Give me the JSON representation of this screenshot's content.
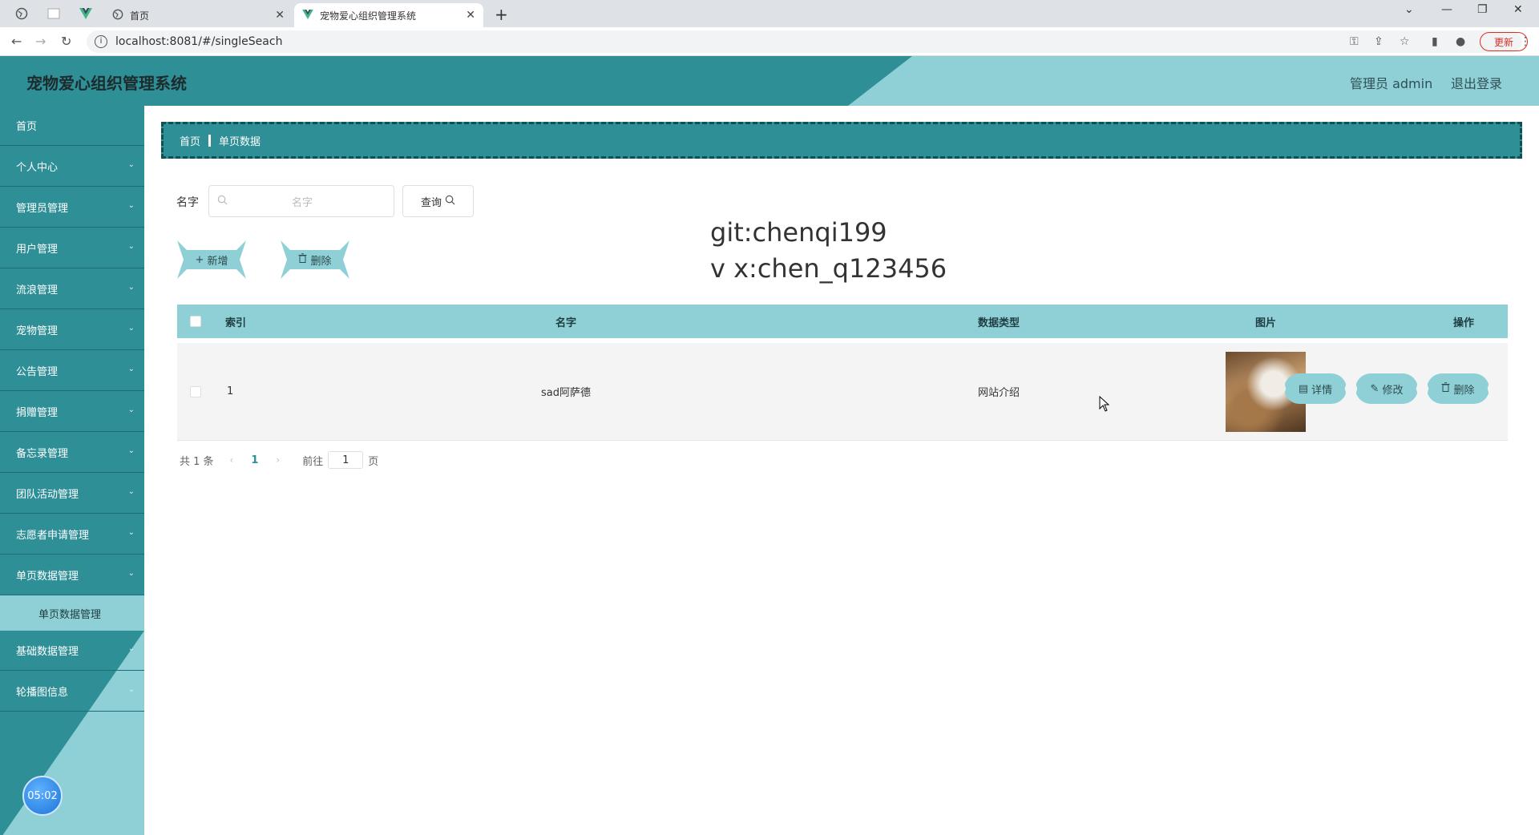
{
  "browser": {
    "inactive_tab_title": "首页",
    "active_tab_title": "宠物爱心组织管理系统",
    "url": "localhost:8081/#/singleSeach",
    "update_label": "更新"
  },
  "header": {
    "title": "宠物爱心组织管理系统",
    "user": "管理员 admin",
    "logout": "退出登录"
  },
  "sidebar": {
    "items": [
      {
        "label": "首页"
      },
      {
        "label": "个人中心"
      },
      {
        "label": "管理员管理"
      },
      {
        "label": "用户管理"
      },
      {
        "label": "流浪管理"
      },
      {
        "label": "宠物管理"
      },
      {
        "label": "公告管理"
      },
      {
        "label": "捐赠管理"
      },
      {
        "label": "备忘录管理"
      },
      {
        "label": "团队活动管理"
      },
      {
        "label": "志愿者申请管理"
      },
      {
        "label": "单页数据管理"
      },
      {
        "label": "基础数据管理"
      },
      {
        "label": "轮播图信息"
      }
    ],
    "submenu_active": "单页数据管理",
    "timer": "05:02"
  },
  "breadcrumb": {
    "home": "首页",
    "current": "单页数据"
  },
  "search": {
    "label": "名字",
    "placeholder": "名字",
    "button": "查询"
  },
  "actions": {
    "add": "新增",
    "delete": "删除"
  },
  "watermark": {
    "line1": "git:chenqi199",
    "line2": "v x:chen_q123456"
  },
  "table": {
    "headers": {
      "index": "索引",
      "name": "名字",
      "type": "数据类型",
      "image": "图片",
      "ops": "操作"
    },
    "rows": [
      {
        "index": "1",
        "name": "sad阿萨德",
        "type": "网站介绍"
      }
    ],
    "row_actions": {
      "detail": "详情",
      "edit": "修改",
      "delete": "删除"
    }
  },
  "pagination": {
    "total": "共 1 条",
    "current_page": "1",
    "goto_label": "前往",
    "goto_value": "1",
    "page_suffix": "页"
  },
  "colors": {
    "primary": "#2e8f97",
    "light": "#8fd0d6"
  }
}
